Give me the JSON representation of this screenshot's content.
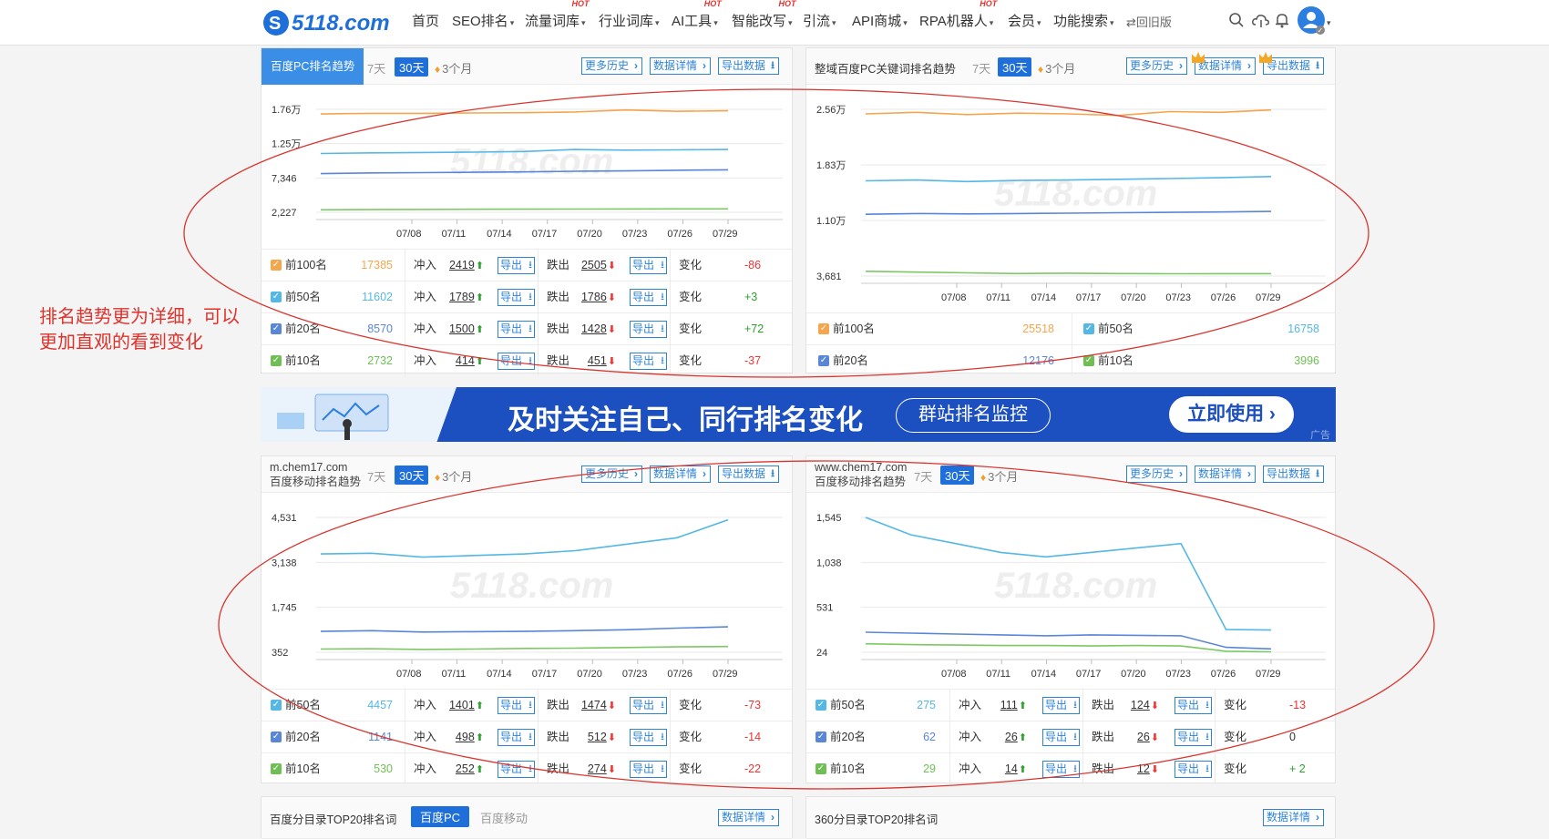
{
  "brand": {
    "logo_text": "5118.com",
    "accent": "#1e6fd9"
  },
  "nav": {
    "items": [
      {
        "label": "首页",
        "caret": false,
        "hot": false
      },
      {
        "label": "SEO排名",
        "caret": true,
        "hot": false
      },
      {
        "label": "流量词库",
        "caret": true,
        "hot": true
      },
      {
        "label": "行业词库",
        "caret": true,
        "hot": false
      },
      {
        "label": "AI工具",
        "caret": true,
        "hot": true
      },
      {
        "label": "智能改写",
        "caret": true,
        "hot": true
      },
      {
        "label": "引流",
        "caret": true,
        "hot": false
      },
      {
        "label": "API商城",
        "caret": true,
        "hot": false
      },
      {
        "label": "RPA机器人",
        "caret": true,
        "hot": true
      },
      {
        "label": "会员",
        "caret": true,
        "hot": false
      },
      {
        "label": "功能搜索",
        "caret": true,
        "hot": false
      },
      {
        "label": "⇄回旧版",
        "caret": false,
        "hot": false
      }
    ],
    "hot_label": "HOT",
    "icons": [
      "search-icon",
      "cloud-icon",
      "bell-icon",
      "avatar-icon"
    ]
  },
  "range_labels": {
    "d7": "7天",
    "d30": "30天",
    "m3": "3个月"
  },
  "buttons": {
    "history": "更多历史",
    "detail": "数据详情",
    "export": "导出数据",
    "export_small": "导出"
  },
  "row_labels": {
    "up": "冲入",
    "down": "跌出",
    "change": "变化"
  },
  "watermark": "5118.com",
  "annotation": {
    "line1": "排名趋势更为详细，可以",
    "line2": "更加直观的看到变化"
  },
  "ad": {
    "headline": "及时关注自己、同行排名变化",
    "pill": "群站排名监控",
    "cta": "立即使用",
    "tag": "广告"
  },
  "panels": [
    {
      "id": "pc-rank",
      "title": "百度PC排名趋势",
      "domain": "",
      "title_active": true,
      "chart_data": {
        "type": "line",
        "x": [
          "07/08",
          "07/11",
          "07/14",
          "07/17",
          "07/20",
          "07/23",
          "07/26",
          "07/29"
        ],
        "yticks": [
          "1.76万",
          "1.25万",
          "7,346",
          "2,227"
        ],
        "ylim": [
          2227,
          17600
        ],
        "series": [
          {
            "name": "前100名",
            "color": "#f5a54b",
            "values": [
              16900,
              17000,
              17000,
              17050,
              17100,
              17200,
              17500,
              17300,
              17385
            ]
          },
          {
            "name": "前50名",
            "color": "#55b7e4",
            "values": [
              11000,
              11100,
              11150,
              11200,
              11300,
              11600,
              11500,
              11550,
              11602
            ]
          },
          {
            "name": "前20名",
            "color": "#5a86d8",
            "values": [
              8000,
              8100,
              8150,
              8200,
              8250,
              8350,
              8400,
              8500,
              8570
            ]
          },
          {
            "name": "前10名",
            "color": "#7cc964",
            "values": [
              2600,
              2620,
              2650,
              2680,
              2690,
              2700,
              2720,
              2730,
              2732
            ]
          }
        ]
      },
      "rows": [
        {
          "label": "前100名",
          "value": "17385",
          "color": "#f5a54b",
          "up": "2419",
          "down": "2505",
          "change": "-86"
        },
        {
          "label": "前50名",
          "value": "11602",
          "color": "#55b7e4",
          "up": "1789",
          "down": "1786",
          "change": "+3"
        },
        {
          "label": "前20名",
          "value": "8570",
          "color": "#5a86d8",
          "up": "1500",
          "down": "1428",
          "change": "+72"
        },
        {
          "label": "前10名",
          "value": "2732",
          "color": "#6fbf55",
          "up": "414",
          "down": "451",
          "change": "-37"
        }
      ]
    },
    {
      "id": "pc-kw",
      "title": "整域百度PC关键词排名趋势",
      "domain": "",
      "title_active": false,
      "chart_data": {
        "type": "line",
        "x": [
          "07/08",
          "07/11",
          "07/14",
          "07/17",
          "07/20",
          "07/23",
          "07/26",
          "07/29"
        ],
        "yticks": [
          "2.56万",
          "1.83万",
          "1.10万",
          "3,681"
        ],
        "ylim": [
          3681,
          25600
        ],
        "series": [
          {
            "name": "前100名",
            "color": "#f5a54b",
            "values": [
              25000,
              25200,
              24900,
              25100,
              25000,
              24800,
              25300,
              25200,
              25518
            ]
          },
          {
            "name": "前50名",
            "color": "#55b7e4",
            "values": [
              16200,
              16300,
              16100,
              16250,
              16300,
              16400,
              16500,
              16600,
              16758
            ]
          },
          {
            "name": "前20名",
            "color": "#5a86d8",
            "values": [
              11800,
              11900,
              11850,
              11900,
              11950,
              12000,
              12050,
              12100,
              12176
            ]
          },
          {
            "name": "前10名",
            "color": "#7cc964",
            "values": [
              4300,
              4200,
              4100,
              4000,
              4050,
              4000,
              3980,
              3990,
              3996
            ]
          }
        ]
      },
      "summary": [
        {
          "label": "前100名",
          "value": "25518",
          "color": "#f5a54b"
        },
        {
          "label": "前50名",
          "value": "16758",
          "color": "#55b7e4"
        },
        {
          "label": "前20名",
          "value": "12176",
          "color": "#5a86d8"
        },
        {
          "label": "前10名",
          "value": "3996",
          "color": "#6fbf55"
        }
      ]
    },
    {
      "id": "m-rank",
      "title": "百度移动排名趋势",
      "domain": "m.chem17.com",
      "title_active": false,
      "chart_data": {
        "type": "line",
        "x": [
          "07/08",
          "07/11",
          "07/14",
          "07/17",
          "07/20",
          "07/23",
          "07/26",
          "07/29"
        ],
        "yticks": [
          "4,531",
          "3,138",
          "1,745",
          "352"
        ],
        "ylim": [
          352,
          4531
        ],
        "series": [
          {
            "name": "前50名",
            "color": "#55b7e4",
            "values": [
              3400,
              3420,
              3300,
              3350,
              3400,
              3500,
              3700,
              3900,
              4457
            ]
          },
          {
            "name": "前20名",
            "color": "#5a86d8",
            "values": [
              1000,
              1020,
              980,
              990,
              1000,
              1020,
              1050,
              1100,
              1141
            ]
          },
          {
            "name": "前10名",
            "color": "#7cc964",
            "values": [
              450,
              460,
              440,
              450,
              470,
              480,
              500,
              520,
              530
            ]
          }
        ]
      },
      "rows": [
        {
          "label": "前50名",
          "value": "4457",
          "color": "#55b7e4",
          "up": "1401",
          "down": "1474",
          "change": "-73"
        },
        {
          "label": "前20名",
          "value": "1141",
          "color": "#5a86d8",
          "up": "498",
          "down": "512",
          "change": "-14"
        },
        {
          "label": "前10名",
          "value": "530",
          "color": "#6fbf55",
          "up": "252",
          "down": "274",
          "change": "-22"
        }
      ]
    },
    {
      "id": "m-www",
      "title": "百度移动排名趋势",
      "domain": "www.chem17.com",
      "title_active": false,
      "chart_data": {
        "type": "line",
        "x": [
          "07/08",
          "07/11",
          "07/14",
          "07/17",
          "07/20",
          "07/23",
          "07/26",
          "07/29"
        ],
        "yticks": [
          "1,545",
          "1,038",
          "531",
          "24"
        ],
        "ylim": [
          24,
          1545
        ],
        "series": [
          {
            "name": "前50名",
            "color": "#55b7e4",
            "values": [
              1545,
              1350,
              1250,
              1150,
              1100,
              1150,
              1200,
              1250,
              280,
              275
            ]
          },
          {
            "name": "前20名",
            "color": "#5a86d8",
            "values": [
              250,
              240,
              230,
              220,
              210,
              220,
              215,
              210,
              80,
              62
            ]
          },
          {
            "name": "前10名",
            "color": "#7cc964",
            "values": [
              120,
              110,
              105,
              100,
              100,
              95,
              100,
              95,
              35,
              29
            ]
          }
        ]
      },
      "rows": [
        {
          "label": "前50名",
          "value": "275",
          "color": "#55b7e4",
          "up": "111",
          "down": "124",
          "change": "-13"
        },
        {
          "label": "前20名",
          "value": "62",
          "color": "#5a86d8",
          "up": "26",
          "down": "26",
          "change": "0"
        },
        {
          "label": "前10名",
          "value": "29",
          "color": "#6fbf55",
          "up": "14",
          "down": "12",
          "change": "+ 2"
        }
      ]
    }
  ],
  "bottom": {
    "left_title": "百度分目录TOP20排名词",
    "tab_pc": "百度PC",
    "tab_mobile": "百度移动",
    "right_title": "360分目录TOP20排名词"
  }
}
